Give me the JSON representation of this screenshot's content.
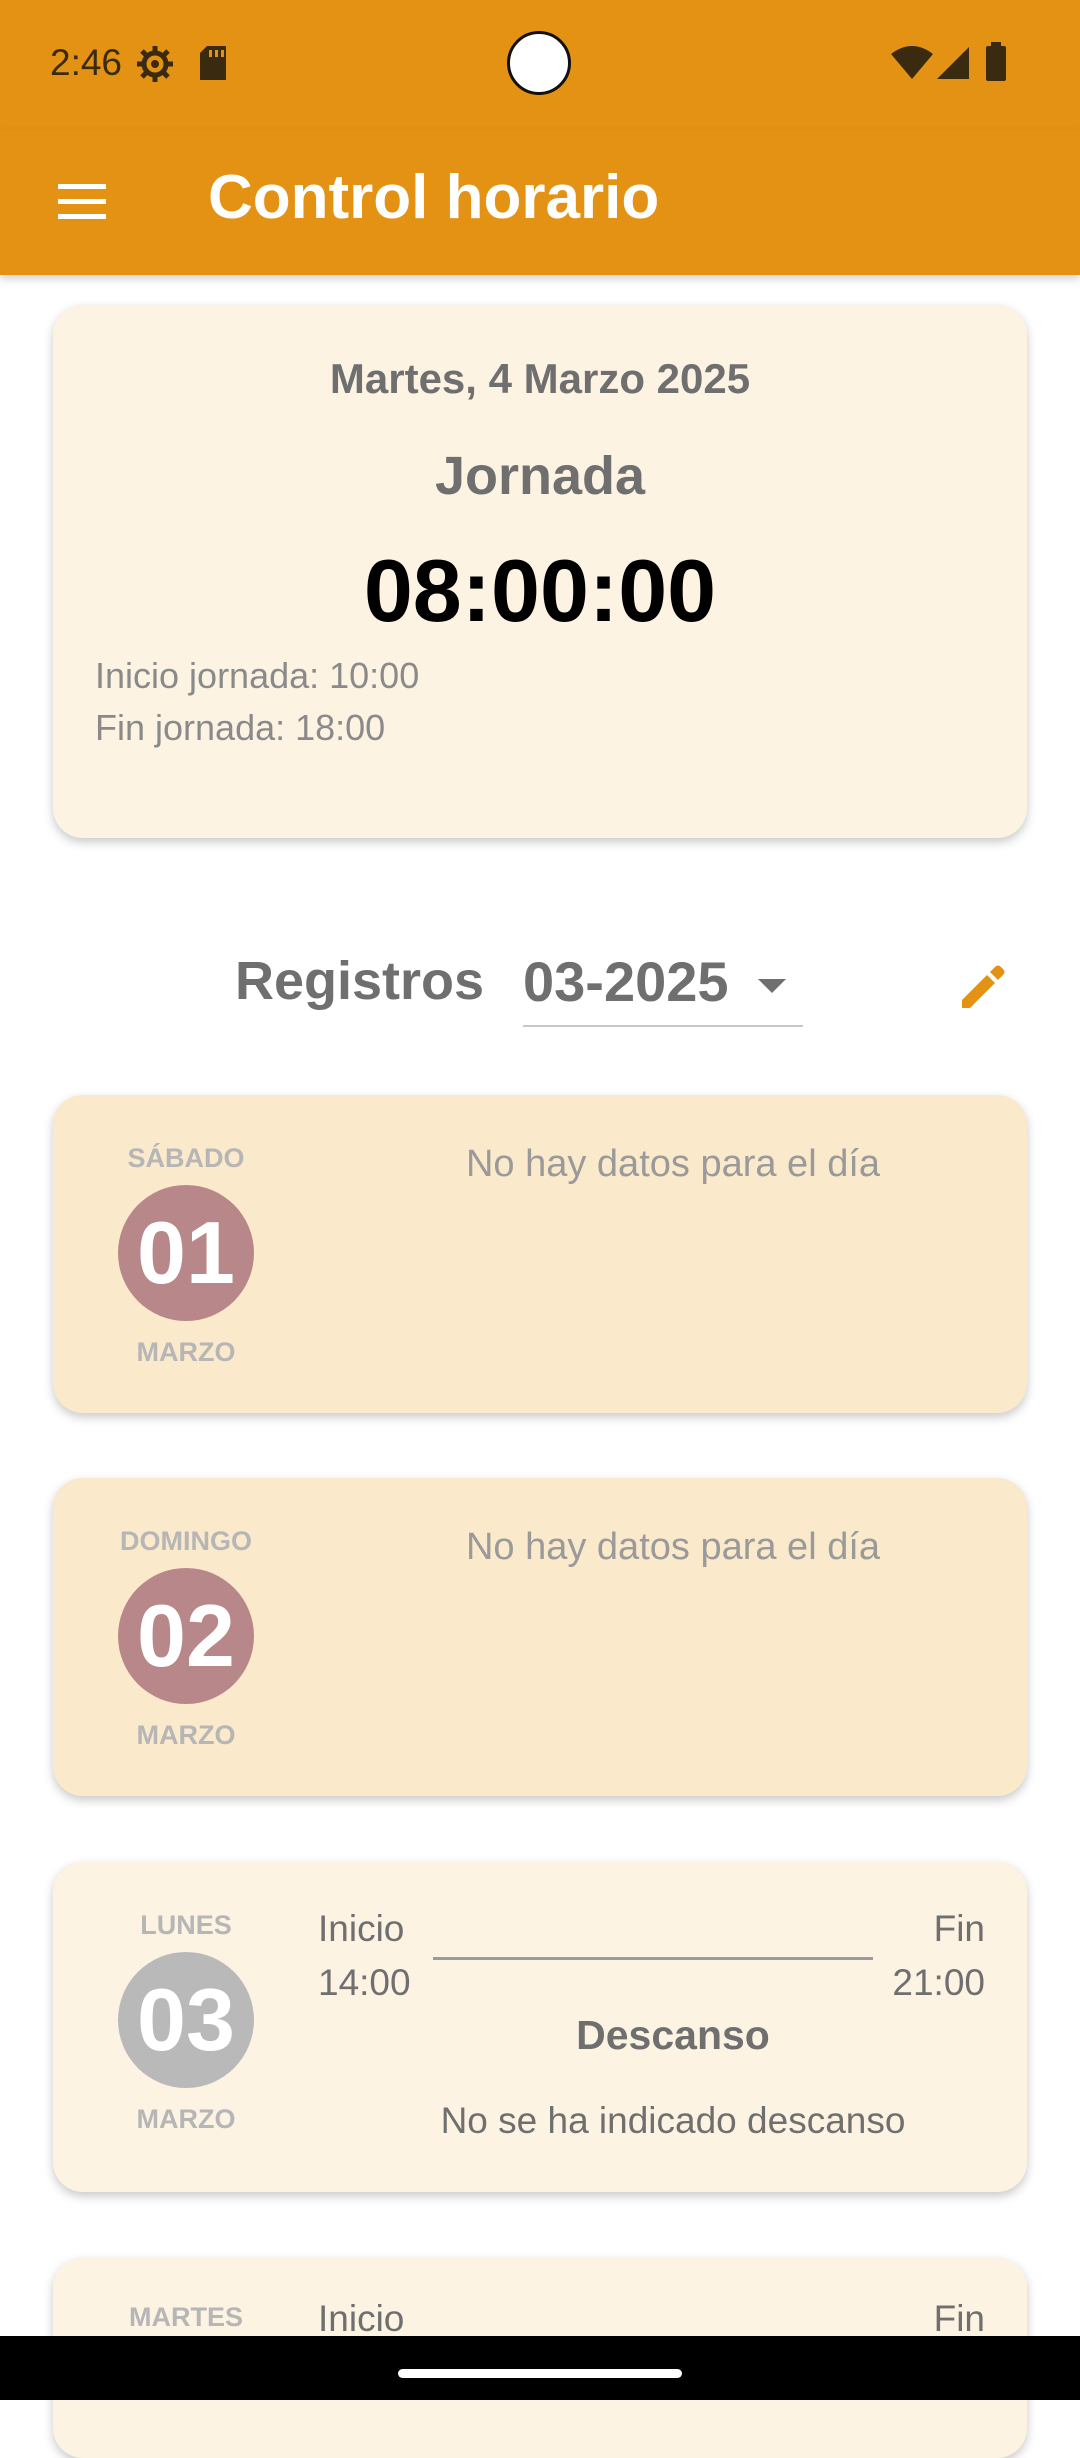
{
  "status_bar": {
    "time": "2:46",
    "icons": [
      "settings-gear-icon",
      "sd-card-icon",
      "wifi-icon",
      "cell-signal-icon",
      "battery-icon"
    ]
  },
  "app_bar": {
    "title": "Control horario",
    "menu_icon": "hamburger-menu-icon",
    "background": "#e39214"
  },
  "today": {
    "date": "Martes, 4 Marzo 2025",
    "label": "Jornada",
    "total": "08:00:00",
    "start_line": "Inicio jornada: 10:00",
    "end_line": "Fin jornada: 18:00"
  },
  "records": {
    "label": "Registros",
    "selected_month": "03-2025",
    "edit_icon": "edit-pencil-icon",
    "days": [
      {
        "weekday": "SÁBADO",
        "day": "01",
        "month": "MARZO",
        "message": "No hay datos para el día",
        "circle_color": "#b88789"
      },
      {
        "weekday": "DOMINGO",
        "day": "02",
        "month": "MARZO",
        "message": "No hay datos para el día",
        "circle_color": "#b88789"
      },
      {
        "weekday": "LUNES",
        "day": "03",
        "month": "MARZO",
        "start_label": "Inicio",
        "start_time": "14:00",
        "end_label": "Fin",
        "end_time": "21:00",
        "break_title": "Descanso",
        "break_note": "No se ha indicado descanso",
        "circle_color": "#b9b9b9"
      },
      {
        "weekday": "MARTES",
        "start_label": "Inicio",
        "end_label": "Fin"
      }
    ]
  },
  "colors": {
    "accent": "#e39214",
    "empty_day_card": "#fbe9cb",
    "card": "#fdf3e3",
    "weekend_circle": "#b88789",
    "weekday_circle": "#b9b9b9"
  }
}
